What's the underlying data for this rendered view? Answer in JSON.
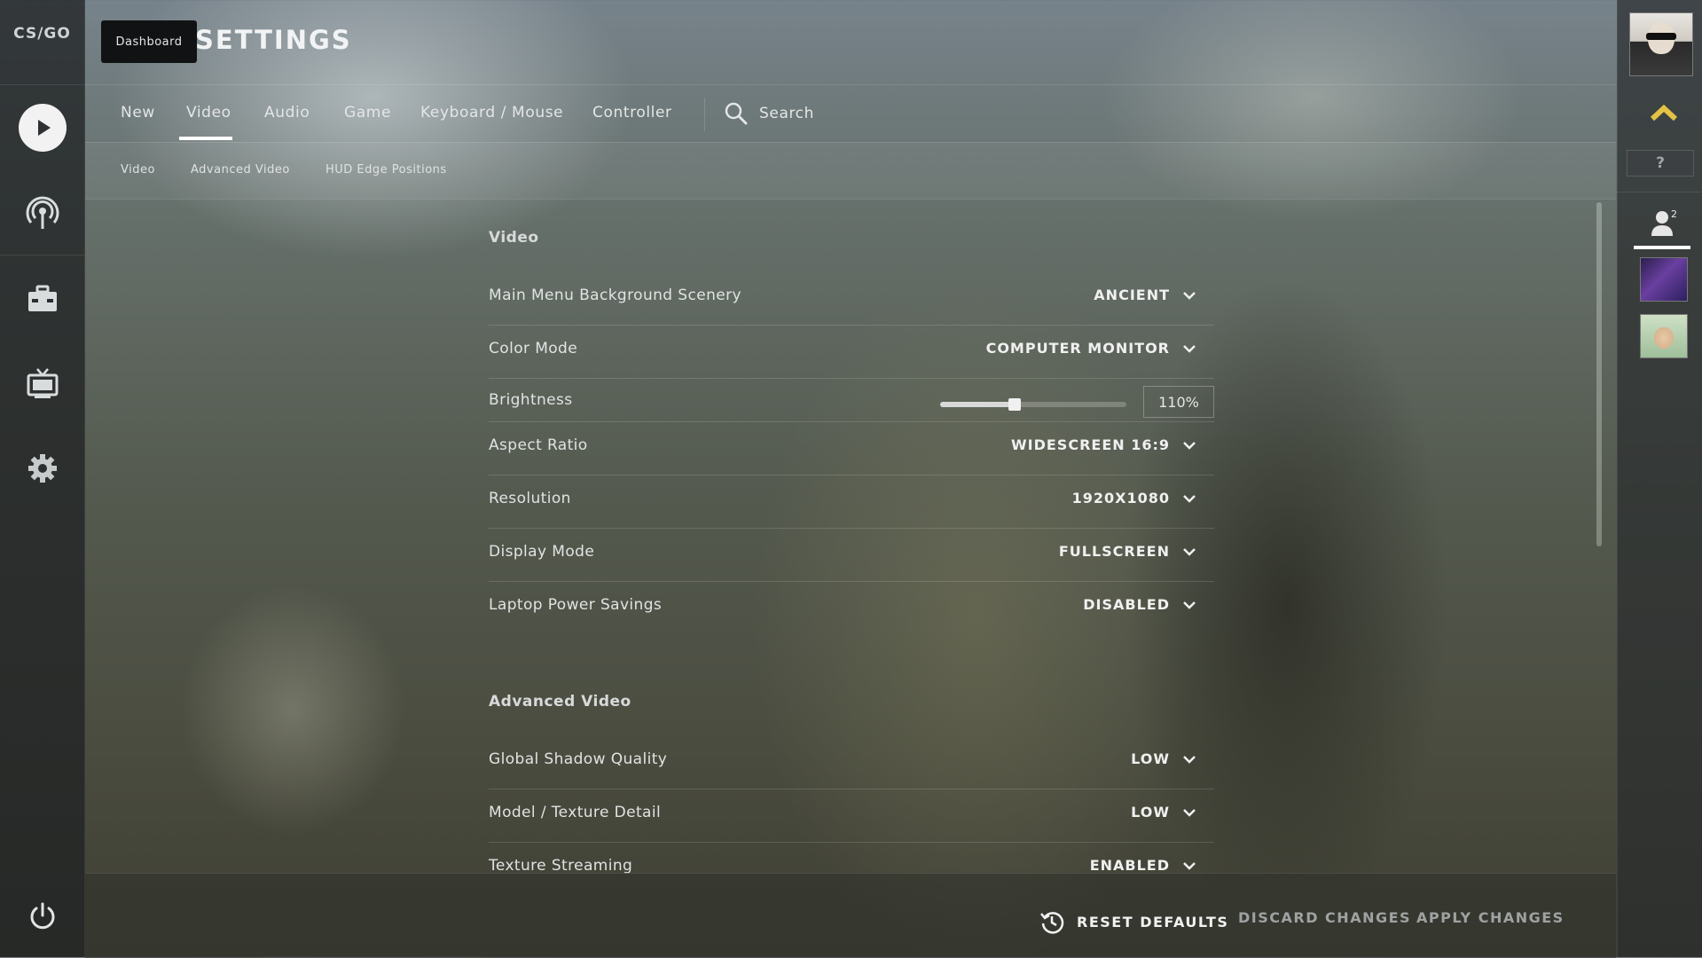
{
  "app": {
    "logo_text": "CS/GO",
    "page_title": "SETTINGS",
    "tooltip": "Dashboard"
  },
  "tabs": [
    {
      "label": "New"
    },
    {
      "label": "Video"
    },
    {
      "label": "Audio"
    },
    {
      "label": "Game"
    },
    {
      "label": "Keyboard / Mouse"
    },
    {
      "label": "Controller"
    }
  ],
  "active_tab": "Video",
  "search": {
    "label": "Search"
  },
  "subtabs": [
    {
      "label": "Video"
    },
    {
      "label": "Advanced Video"
    },
    {
      "label": "HUD Edge Positions"
    }
  ],
  "sections": {
    "video": {
      "title": "Video",
      "rows": [
        {
          "label": "Main Menu Background Scenery",
          "value": "ANCIENT"
        },
        {
          "label": "Color Mode",
          "value": "COMPUTER MONITOR"
        },
        {
          "label": "Brightness",
          "value": "110%",
          "slider_fraction": 0.4
        },
        {
          "label": "Aspect Ratio",
          "value": "WIDESCREEN 16:9"
        },
        {
          "label": "Resolution",
          "value": "1920X1080"
        },
        {
          "label": "Display Mode",
          "value": "FULLSCREEN"
        },
        {
          "label": "Laptop Power Savings",
          "value": "DISABLED"
        }
      ]
    },
    "advanced": {
      "title": "Advanced Video",
      "rows": [
        {
          "label": "Global Shadow Quality",
          "value": "LOW"
        },
        {
          "label": "Model / Texture Detail",
          "value": "LOW"
        },
        {
          "label": "Texture Streaming",
          "value": "ENABLED"
        }
      ]
    }
  },
  "footer": {
    "reset": "RESET DEFAULTS",
    "discard": "DISCARD CHANGES",
    "apply": "APPLY CHANGES"
  },
  "right_rail": {
    "help": "?",
    "friend_count": "2"
  },
  "colors": {
    "accent_yellow": "#e3c245",
    "text_primary": "#e8e8e8",
    "text_dim": "#9ea2a2"
  },
  "icons": {
    "rail": [
      "play-icon",
      "antenna-icon",
      "briefcase-icon",
      "tv-icon",
      "gear-icon",
      "power-icon"
    ],
    "tabs": [
      "search-icon"
    ],
    "footer": [
      "history-icon"
    ],
    "right_rail": [
      "chevron-up-icon",
      "friends-icon"
    ]
  }
}
